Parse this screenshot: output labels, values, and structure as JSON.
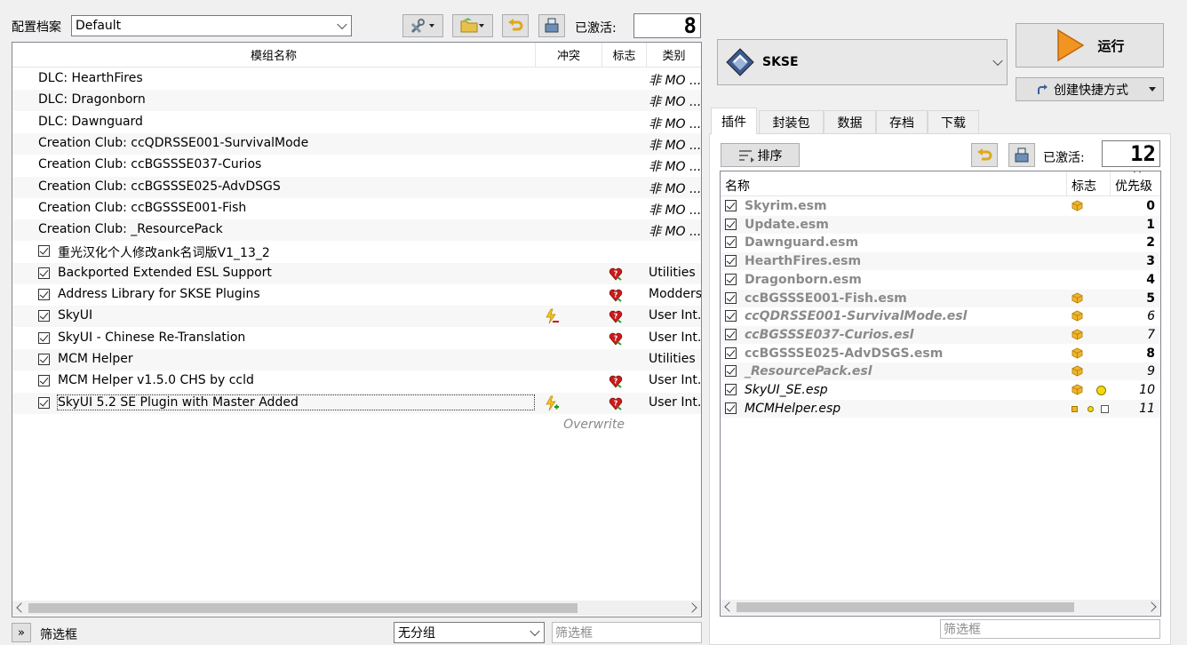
{
  "top": {
    "profile_label": "配置档案",
    "profile_value": "Default",
    "active_label": "已激活:",
    "active_count": "8"
  },
  "modlist": {
    "columns": [
      "模组名称",
      "冲突",
      "标志",
      "类别"
    ],
    "rows": [
      {
        "name": "DLC: HearthFires",
        "category": "非 MO ..."
      },
      {
        "name": "DLC: Dragonborn",
        "category": "非 MO ..."
      },
      {
        "name": "DLC: Dawnguard",
        "category": "非 MO ..."
      },
      {
        "name": "Creation Club: ccQDRSSE001-SurvivalMode",
        "category": "非 MO ..."
      },
      {
        "name": "Creation Club: ccBGSSSE037-Curios",
        "category": "非 MO ..."
      },
      {
        "name": "Creation Club: ccBGSSSE025-AdvDSGS",
        "category": "非 MO ..."
      },
      {
        "name": "Creation Club: ccBGSSSE001-Fish",
        "category": "非 MO ..."
      },
      {
        "name": "Creation Club: _ResourcePack",
        "category": "非 MO ..."
      },
      {
        "name": "重光汉化个人修改ank名词版V1_13_2",
        "category": ""
      },
      {
        "name": "Backported Extended ESL Support",
        "category": "Utilities"
      },
      {
        "name": "Address Library for SKSE Plugins",
        "category": "Modders"
      },
      {
        "name": "SkyUI",
        "category": "User Int..."
      },
      {
        "name": "SkyUI - Chinese Re-Translation",
        "category": "User Int..."
      },
      {
        "name": "MCM Helper",
        "category": "Utilities"
      },
      {
        "name": "MCM Helper v1.5.0 CHS by ccld",
        "category": "User Int..."
      },
      {
        "name": "SkyUI 5.2 SE Plugin with Master Added",
        "category": "User Int..."
      }
    ],
    "overwrite": "Overwrite"
  },
  "bottom_left": {
    "expander": "»",
    "filter_label": "筛选框",
    "group_value": "无分组",
    "filter_placeholder": "筛选框"
  },
  "right": {
    "executable": "SKSE",
    "run_label": "运行",
    "shortcut_label": "创建快捷方式",
    "tabs": [
      "插件",
      "封装包",
      "数据",
      "存档",
      "下载"
    ],
    "sort_label": "排序",
    "active_label": "已激活:",
    "active_count": "12",
    "columns": [
      "名称",
      "标志",
      "优先级"
    ],
    "plugins": [
      {
        "name": "Skyrim.esm",
        "priority": "0"
      },
      {
        "name": "Update.esm",
        "priority": "1"
      },
      {
        "name": "Dawnguard.esm",
        "priority": "2"
      },
      {
        "name": "HearthFires.esm",
        "priority": "3"
      },
      {
        "name": "Dragonborn.esm",
        "priority": "4"
      },
      {
        "name": "ccBGSSSE001-Fish.esm",
        "priority": "5"
      },
      {
        "name": "ccQDRSSE001-SurvivalMode.esl",
        "priority": "6"
      },
      {
        "name": "ccBGSSSE037-Curios.esl",
        "priority": "7"
      },
      {
        "name": "ccBGSSSE025-AdvDSGS.esm",
        "priority": "8"
      },
      {
        "name": "_ResourcePack.esl",
        "priority": "9"
      },
      {
        "name": "SkyUI_SE.esp",
        "priority": "10"
      },
      {
        "name": "MCMHelper.esp",
        "priority": "11"
      }
    ],
    "filter_placeholder": "筛选框"
  },
  "colors": {
    "accent": "#f29422",
    "selection": "#cce8ff",
    "heart": "#cc1a1a",
    "cube": "#f0b429"
  }
}
